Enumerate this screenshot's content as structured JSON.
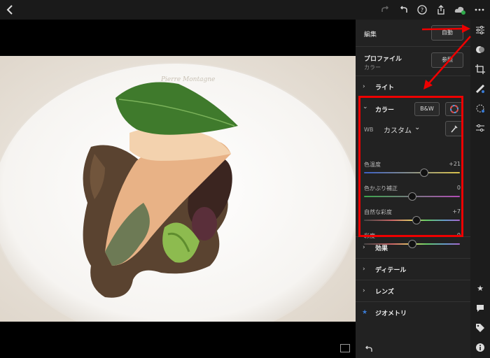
{
  "topbar": {
    "back_icon": "chevron-left-icon",
    "redo_icon": "redo-icon",
    "undo_icon": "undo-icon",
    "help_icon": "question-icon",
    "share_icon": "share-icon",
    "cloud_icon": "cloud-icon",
    "more_icon": "ellipsis-icon"
  },
  "photo": {
    "watermark": "Pierre Montagne"
  },
  "panel": {
    "edit_label": "編集",
    "auto_button": "自動",
    "profile_title": "プロファイル",
    "profile_value": "カラー",
    "profile_browse_button": "参照",
    "light_section": "ライト",
    "color_section": "カラー",
    "bw_button": "B&W",
    "wb_label": "WB",
    "wb_value": "カスタム",
    "sliders": [
      {
        "name": "色温度",
        "value": "+21",
        "position": 0.63
      },
      {
        "name": "色かぶり補正",
        "value": "0",
        "position": 0.5
      },
      {
        "name": "自然な彩度",
        "value": "+7",
        "position": 0.55
      },
      {
        "name": "彩度",
        "value": "0",
        "position": 0.5
      }
    ],
    "effects_section": "効果",
    "detail_section": "ディテール",
    "lens_section": "レンズ",
    "geometry_section": "ジオメトリ"
  },
  "rail_icons": [
    "sliders-icon",
    "presets-icon",
    "crop-icon",
    "healing-icon",
    "masking-icon",
    "selective-icon",
    "star-icon",
    "comment-icon",
    "tag-icon",
    "info-icon"
  ],
  "colors": {
    "accent_blue": "#3a7bd5",
    "highlight_red": "#e00000",
    "panel_bg": "#222222"
  }
}
